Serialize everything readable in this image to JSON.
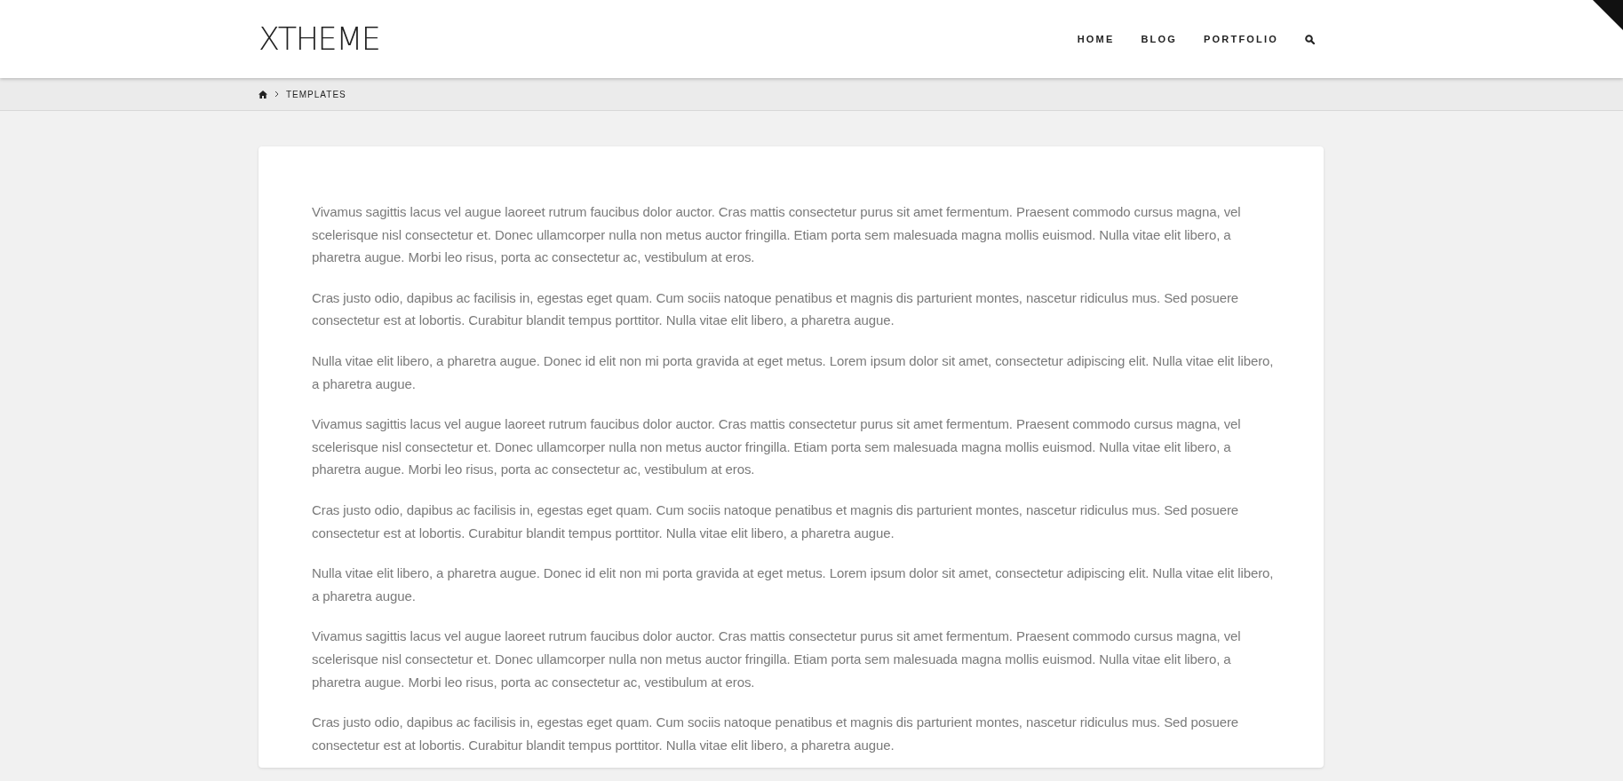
{
  "header": {
    "logo": "XTHEME",
    "nav": [
      {
        "label": "HOME",
        "kind": "link"
      },
      {
        "label": "BLOG",
        "kind": "link"
      },
      {
        "label": "PORTFOLIO",
        "kind": "link"
      },
      {
        "kind": "search"
      }
    ]
  },
  "breadcrumb": {
    "items": [
      "TEMPLATES"
    ]
  },
  "content": {
    "paragraphs": [
      "Vivamus sagittis lacus vel augue laoreet rutrum faucibus dolor auctor. Cras mattis consectetur purus sit amet fermentum. Praesent commodo cursus magna, vel scelerisque nisl consectetur et. Donec ullamcorper nulla non metus auctor fringilla. Etiam porta sem malesuada magna mollis euismod. Nulla vitae elit libero, a pharetra augue. Morbi leo risus, porta ac consectetur ac, vestibulum at eros.",
      "Cras justo odio, dapibus ac facilisis in, egestas eget quam. Cum sociis natoque penatibus et magnis dis parturient montes, nascetur ridiculus mus. Sed posuere consectetur est at lobortis. Curabitur blandit tempus porttitor. Nulla vitae elit libero, a pharetra augue.",
      "Nulla vitae elit libero, a pharetra augue. Donec id elit non mi porta gravida at eget metus. Lorem ipsum dolor sit amet, consectetur adipiscing elit. Nulla vitae elit libero, a pharetra augue.",
      "Vivamus sagittis lacus vel augue laoreet rutrum faucibus dolor auctor. Cras mattis consectetur purus sit amet fermentum. Praesent commodo cursus magna, vel scelerisque nisl consectetur et. Donec ullamcorper nulla non metus auctor fringilla. Etiam porta sem malesuada magna mollis euismod. Nulla vitae elit libero, a pharetra augue. Morbi leo risus, porta ac consectetur ac, vestibulum at eros.",
      "Cras justo odio, dapibus ac facilisis in, egestas eget quam. Cum sociis natoque penatibus et magnis dis parturient montes, nascetur ridiculus mus. Sed posuere consectetur est at lobortis. Curabitur blandit tempus porttitor. Nulla vitae elit libero, a pharetra augue.",
      "Nulla vitae elit libero, a pharetra augue. Donec id elit non mi porta gravida at eget metus. Lorem ipsum dolor sit amet, consectetur adipiscing elit. Nulla vitae elit libero, a pharetra augue.",
      "Vivamus sagittis lacus vel augue laoreet rutrum faucibus dolor auctor. Cras mattis consectetur purus sit amet fermentum. Praesent commodo cursus magna, vel scelerisque nisl consectetur et. Donec ullamcorper nulla non metus auctor fringilla. Etiam porta sem malesuada magna mollis euismod. Nulla vitae elit libero, a pharetra augue. Morbi leo risus, porta ac consectetur ac, vestibulum at eros.",
      "Cras justo odio, dapibus ac facilisis in, egestas eget quam. Cum sociis natoque penatibus et magnis dis parturient montes, nascetur ridiculus mus. Sed posuere consectetur est at lobortis. Curabitur blandit tempus porttitor. Nulla vitae elit libero, a pharetra augue."
    ]
  }
}
